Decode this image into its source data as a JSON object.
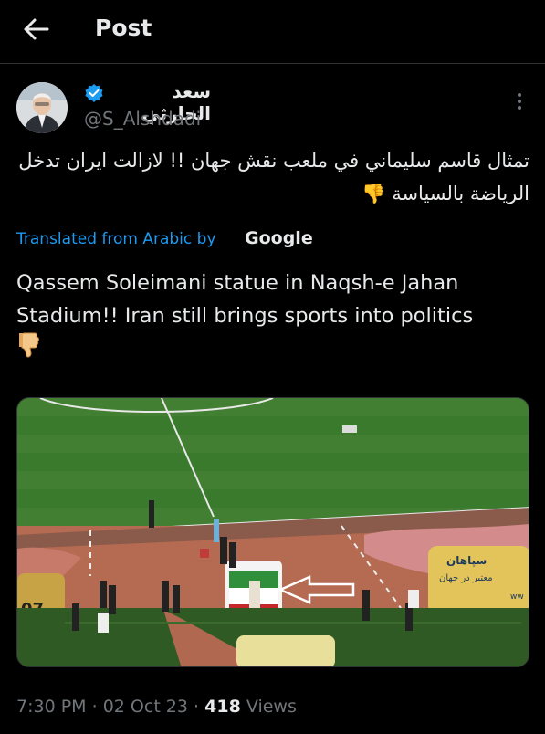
{
  "header": {
    "title": "Post"
  },
  "author": {
    "display_name": "سعد الحارثي",
    "handle": "@S_Alshdadi"
  },
  "tweet": {
    "original_text": "تمثال قاسم سليماني في ملعب نقش جهان !! لازالت ايران تدخل الرياضة بالسياسة 👎",
    "translated_label": "Translated from Arabic by",
    "translator": "Google",
    "translated_text": "Qassem Soleimani statue in Naqsh-e Jahan Stadium!! Iran still brings sports into politics"
  },
  "media": {
    "banner_right_line1": "سپاهان",
    "banner_right_line2": "معتبر در جهان",
    "banner_right_line3": "ww",
    "banner_left": "07"
  },
  "meta": {
    "time": "7:30 PM",
    "date": "02 Oct 23",
    "views_count": "418",
    "views_label": "Views"
  },
  "colors": {
    "accent": "#1d9bf0",
    "muted": "#71767b",
    "text": "#e7e9ea",
    "background": "#000000"
  },
  "icons": [
    "back-arrow-icon",
    "verified-badge-icon",
    "more-options-icon",
    "thumbs-down-icon"
  ]
}
